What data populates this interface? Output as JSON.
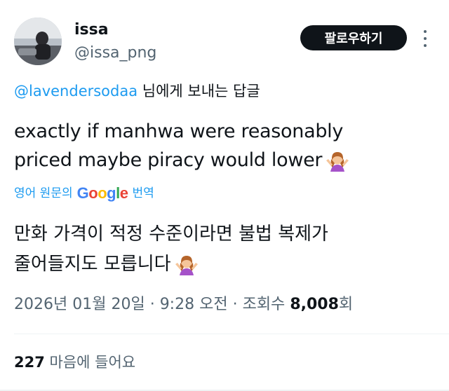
{
  "author": {
    "display_name": "issa",
    "handle": "@issa_png"
  },
  "follow_button_label": "팔로우하기",
  "reply_context": {
    "mention": "@lavendersodaa",
    "suffix": " 님에게 보내는 답글"
  },
  "tweet": {
    "lines": [
      "exactly if manhwa were reasonably",
      "priced maybe piracy would lower"
    ],
    "emoji": "person-shrugging-emoji"
  },
  "translation_bar": {
    "prefix": "영어 원문의",
    "brand": "Google",
    "suffix": "번역"
  },
  "translated_text": {
    "lines": [
      "만화 가격이 적정 수준이라면 불법 복제가",
      "줄어들지도 모릅니다"
    ]
  },
  "meta": {
    "date": "2026년 01월 20일",
    "time": "9:28 오전",
    "views_label": "조회수",
    "views_count": "8,008",
    "views_suffix": "회"
  },
  "stats": {
    "likes_count": "227",
    "likes_label": "마음에 들어요"
  },
  "colors": {
    "link_blue": "#1d9bf0",
    "secondary_text": "#536471",
    "primary_text": "#0f1419",
    "button_bg": "#0f1419"
  }
}
